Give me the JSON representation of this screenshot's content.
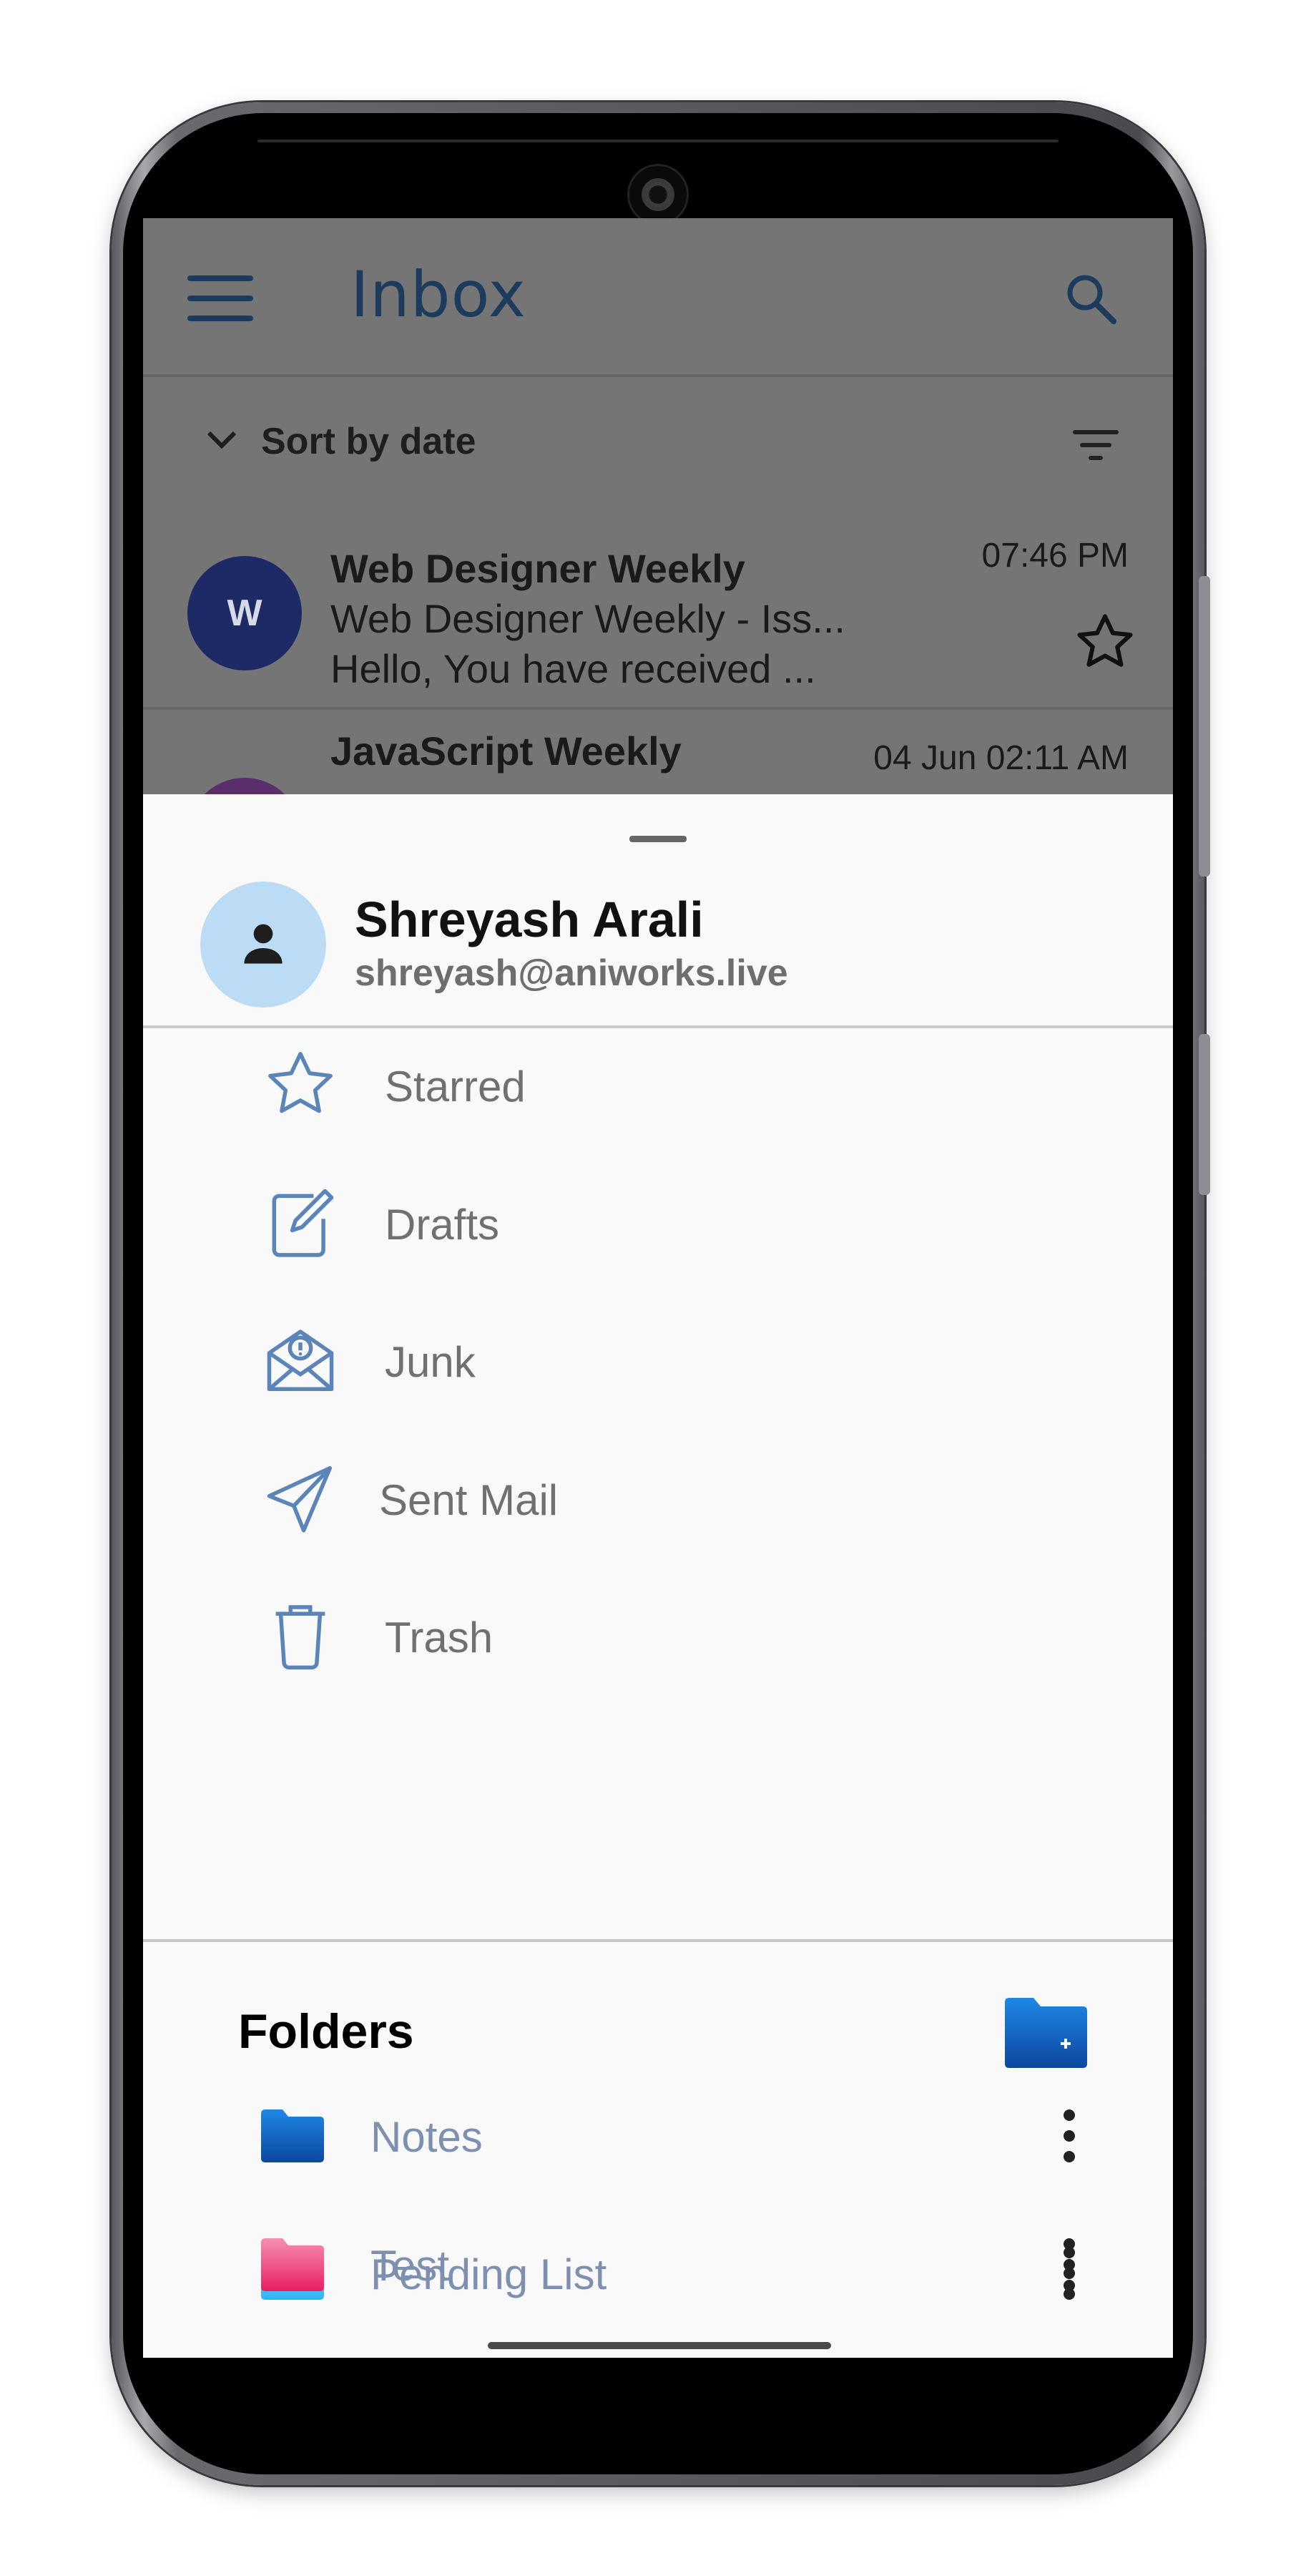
{
  "inbox": {
    "title": "Inbox",
    "sort_label": "Sort by date",
    "mails": [
      {
        "avatar_letter": "W",
        "sender": "Web Designer Weekly",
        "subject": "Web Designer Weekly - Iss...",
        "preview": "Hello, You have received ...",
        "time": "07:46 PM",
        "starred": false
      },
      {
        "sender": "JavaScript Weekly",
        "time": "04 Jun 02:11 AM"
      }
    ]
  },
  "profile": {
    "name": "Shreyash Arali",
    "email": "shreyash@aniworks.live"
  },
  "nav_items": [
    {
      "label": "Starred",
      "icon": "star-icon"
    },
    {
      "label": "Drafts",
      "icon": "drafts-icon"
    },
    {
      "label": "Junk",
      "icon": "junk-icon"
    },
    {
      "label": "Sent Mail",
      "icon": "send-icon"
    },
    {
      "label": "Trash",
      "icon": "trash-icon"
    }
  ],
  "folders": {
    "title": "Folders",
    "items": [
      {
        "label": "Notes",
        "color": "#1565c0"
      },
      {
        "label": "Pending List",
        "color": "#4fc3f7"
      },
      {
        "label": "Test",
        "color": "#ec407a"
      }
    ]
  },
  "colors": {
    "accent": "#1d3b5c",
    "icon_blue": "#5b84b8",
    "folder_label": "#7e90b0",
    "scrim": "#757575"
  }
}
